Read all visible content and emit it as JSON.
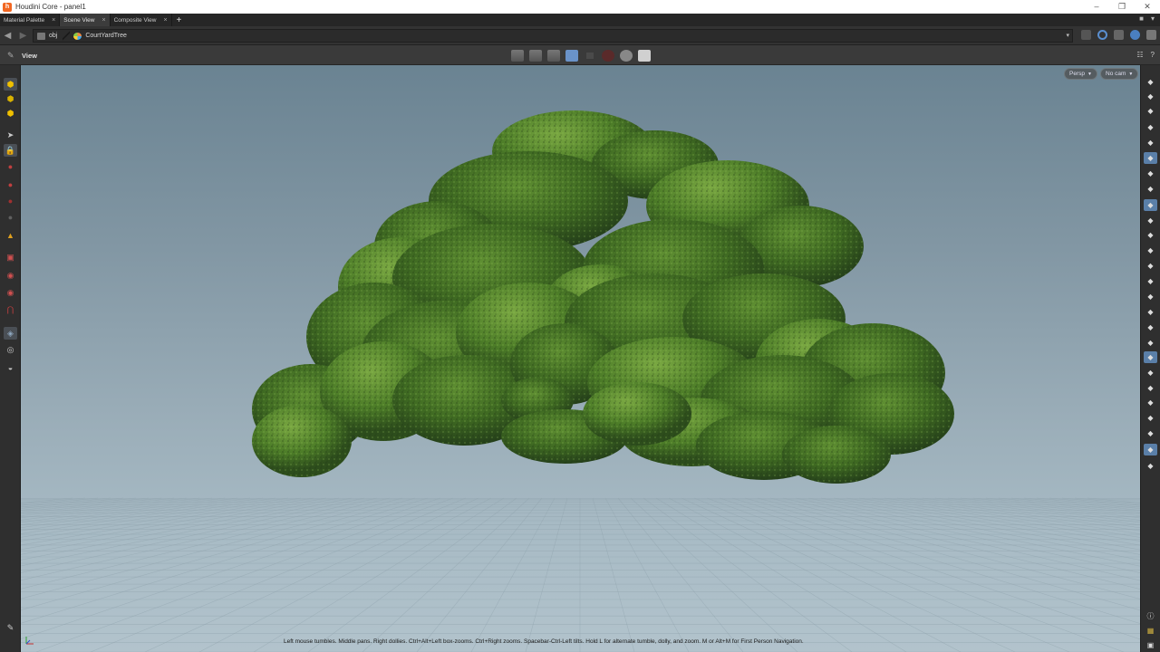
{
  "window": {
    "title": "Houdini Core - panel1",
    "app_icon_letter": "h",
    "controls": [
      "–",
      "❐",
      "✕"
    ]
  },
  "tabs": [
    {
      "label": "Material Palette",
      "active": false
    },
    {
      "label": "Scene View",
      "active": true
    },
    {
      "label": "Composite View",
      "active": false
    }
  ],
  "tab_add_label": "+",
  "path": {
    "back": "◀",
    "forward": "▶",
    "crumbs": [
      {
        "label": "obj",
        "kind": "obj"
      },
      {
        "label": "CourtYardTree",
        "kind": "geo"
      }
    ],
    "dropdown": "▾"
  },
  "viewer": {
    "pane_label": "View",
    "camera_persp": "Persp",
    "camera_cam": "No cam",
    "status_text": "Left mouse tumbles. Middle pans. Right dollies. Ctrl+Alt+Left box-zooms. Ctrl+Right zooms. Spacebar-Ctrl-Left tilts. Hold L for alternate tumble, dolly, and zoom.     M or Alt+M for First Person Navigation."
  },
  "left_tools": [
    {
      "name": "select-tool-icon",
      "color": "#f0c000"
    },
    {
      "name": "select-component-icon",
      "color": "#d9b200"
    },
    {
      "name": "select-object-icon",
      "color": "#f0c000"
    },
    {
      "name": "pointer-icon",
      "color": "#cccccc"
    },
    {
      "name": "lock-icon",
      "color": "#8fa8c0"
    },
    {
      "name": "move-icon",
      "color": "#c04040"
    },
    {
      "name": "rotate-icon",
      "color": "#c04040"
    },
    {
      "name": "scale-icon",
      "color": "#a03030"
    },
    {
      "name": "pose-icon",
      "color": "#606060"
    },
    {
      "name": "handle-icon",
      "color": "#e0a020"
    },
    {
      "name": "transform-box-icon",
      "color": "#d05050"
    },
    {
      "name": "lasso-icon",
      "color": "#d05050"
    },
    {
      "name": "paint-icon",
      "color": "#d05050"
    },
    {
      "name": "magnet-icon",
      "color": "#d04040"
    },
    {
      "name": "snap-icon",
      "color": "#8fa8c0"
    },
    {
      "name": "orbit-icon",
      "color": "#cccccc"
    },
    {
      "name": "render-icon",
      "color": "#cccccc"
    }
  ],
  "right_tools_count": 26
}
